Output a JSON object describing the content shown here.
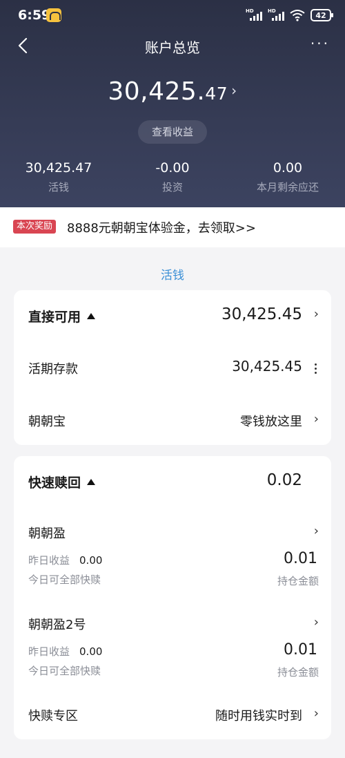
{
  "status": {
    "time": "6:59",
    "battery": "42",
    "hd1": "HD",
    "hd2": "HD"
  },
  "nav": {
    "title": "账户总览",
    "more": "···"
  },
  "total": {
    "int": "30,425.",
    "dec": "47"
  },
  "view_earnings_label": "查看收益",
  "summary": [
    {
      "value": "30,425.47",
      "label": "活钱"
    },
    {
      "value": "-0.00",
      "label": "投资"
    },
    {
      "value": "0.00",
      "label": "本月剩余应还"
    }
  ],
  "promo": {
    "tag": "本次奖励",
    "text": "8888元朝朝宝体验金，去领取>>"
  },
  "section_title": "活钱",
  "direct": {
    "title": "直接可用",
    "value": "30,425.45",
    "items": [
      {
        "label": "活期存款",
        "value": "30,425.45"
      },
      {
        "label": "朝朝宝",
        "value": "零钱放这里"
      }
    ]
  },
  "quick": {
    "title": "快速赎回",
    "value": "0.02",
    "products": [
      {
        "name": "朝朝盈",
        "yesterday_label": "昨日收益",
        "yesterday_value": "0.00",
        "note": "今日可全部快赎",
        "amount": "0.01",
        "amount_label": "持仓金额"
      },
      {
        "name": "朝朝盈2号",
        "yesterday_label": "昨日收益",
        "yesterday_value": "0.00",
        "note": "今日可全部快赎",
        "amount": "0.01",
        "amount_label": "持仓金额"
      }
    ],
    "zone": {
      "label": "快赎专区",
      "value": "随时用钱实时到"
    }
  },
  "chevron": "›",
  "colors": {
    "header": "#2b3045",
    "accent": "#3a8fd6",
    "promo_tag": "#d94552"
  }
}
